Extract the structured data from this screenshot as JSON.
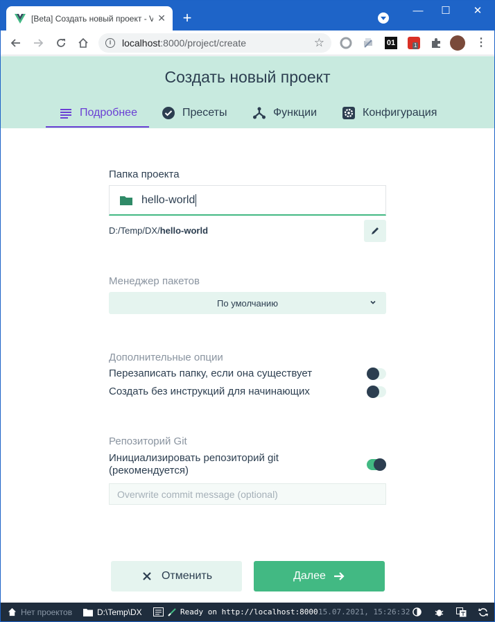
{
  "browser": {
    "tab_title": "[Beta] Создать новый проект - Vue CLI",
    "url_host": "localhost",
    "url_rest": ":8000/project/create",
    "new_tab_label": "+",
    "ext_badge_01": "01",
    "ext_badge_count": "1"
  },
  "page": {
    "title": "Создать новый проект",
    "steps": [
      {
        "label": "Подробнее",
        "icon": "details-list-icon"
      },
      {
        "label": "Пресеты",
        "icon": "check-circle-icon"
      },
      {
        "label": "Функции",
        "icon": "fork-icon"
      },
      {
        "label": "Конфигурация",
        "icon": "gear-icon"
      }
    ]
  },
  "form": {
    "folder_label": "Папка проекта",
    "folder_value": "hello-world",
    "path_prefix": "D:/Temp/DX/",
    "path_name": "hello-world",
    "package_manager_label": "Менеджер пакетов",
    "package_manager_value": "По умолчанию",
    "extra_options_label": "Дополнительные опции",
    "overwrite_label": "Перезаписать папку, если она существует",
    "overwrite_on": false,
    "no_instructions_label": "Создать без инструкций для начинающих",
    "no_instructions_on": false,
    "git_label": "Репозиторий Git",
    "git_init_label_1": "Инициализировать репозиторий git",
    "git_init_label_2": "(рекомендуется)",
    "git_init_on": true,
    "commit_placeholder": "Overwrite commit message (optional)"
  },
  "actions": {
    "cancel_label": "Отменить",
    "next_label": "Далее"
  },
  "statusbar": {
    "no_projects": "Нет проектов",
    "cwd": "D:\\Temp\\DX",
    "log": "Ready on http://localhost:8000",
    "datetime": "15.07.2021, 15:26:32"
  },
  "colors": {
    "accent": "#42b983",
    "active_step": "#6a3fd4",
    "header_bg": "#c8eadf",
    "statusbar_bg": "#1f2d3d"
  }
}
